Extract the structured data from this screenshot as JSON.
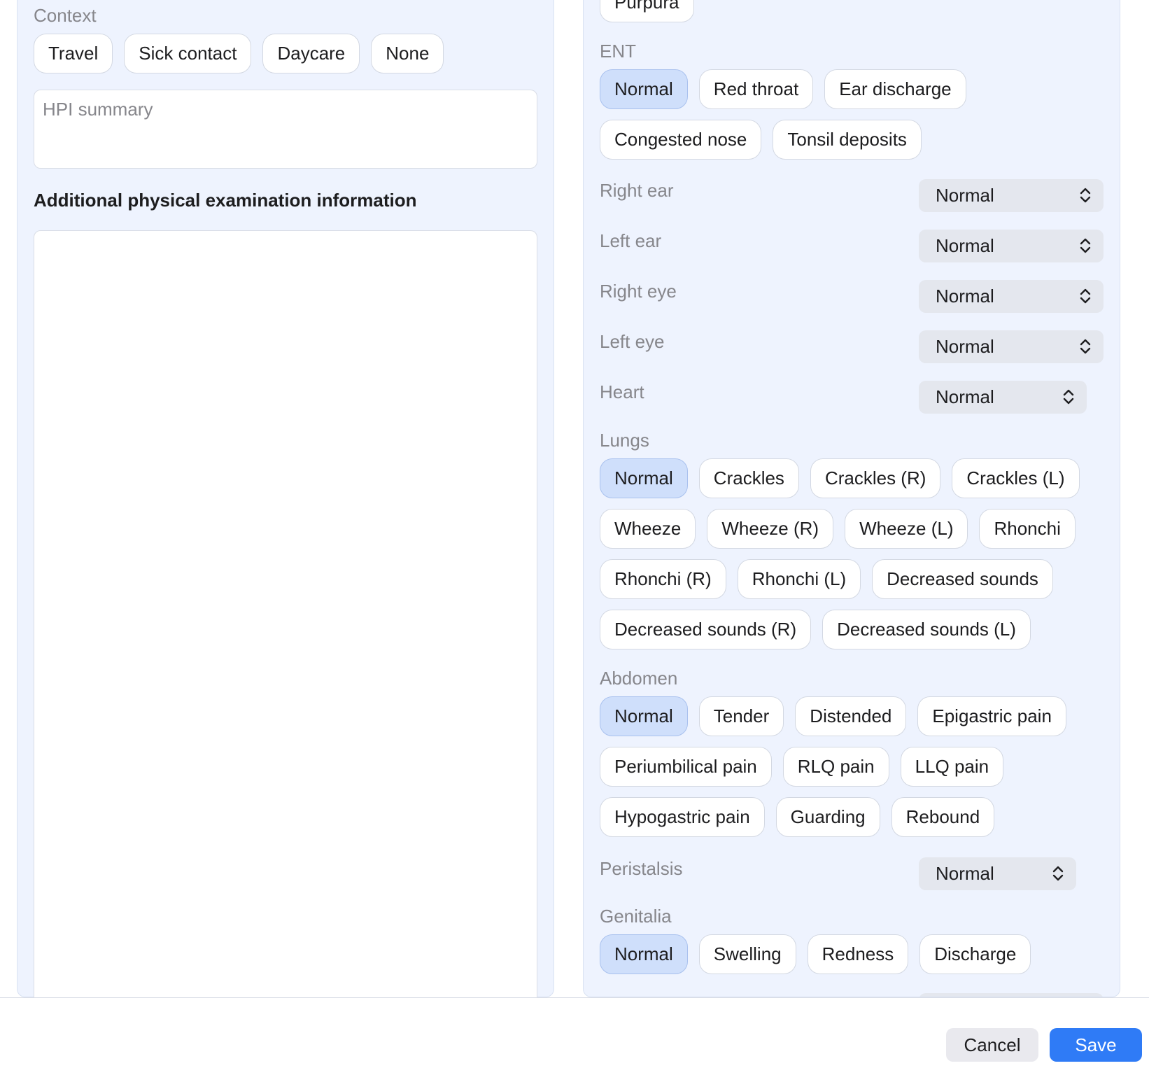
{
  "left": {
    "context_label": "Context",
    "context_chips": [
      "Travel",
      "Sick contact",
      "Daycare",
      "None"
    ],
    "hpi_placeholder": "HPI summary",
    "additional_heading": "Additional physical examination information"
  },
  "right": {
    "top_chip": "Purpura",
    "ent": {
      "label": "ENT",
      "row1": [
        "Normal",
        "Red throat",
        "Ear discharge"
      ],
      "row2": [
        "Congested nose",
        "Tonsil deposits"
      ]
    },
    "selects": [
      {
        "label": "Right ear",
        "value": "Normal"
      },
      {
        "label": "Left ear",
        "value": "Normal"
      },
      {
        "label": "Right eye",
        "value": "Normal"
      },
      {
        "label": "Left eye",
        "value": "Normal"
      },
      {
        "label": "Heart",
        "value": "Normal"
      }
    ],
    "lungs": {
      "label": "Lungs",
      "row1": [
        "Normal",
        "Crackles",
        "Crackles (R)",
        "Crackles (L)"
      ],
      "row2": [
        "Wheeze",
        "Wheeze (R)",
        "Wheeze (L)",
        "Rhonchi"
      ],
      "row3": [
        "Rhonchi (R)",
        "Rhonchi (L)",
        "Decreased sounds"
      ],
      "row4": [
        "Decreased sounds (R)",
        "Decreased sounds (L)"
      ]
    },
    "abdomen": {
      "label": "Abdomen",
      "row1": [
        "Normal",
        "Tender",
        "Distended",
        "Epigastric pain"
      ],
      "row2": [
        "Periumbilical pain",
        "RLQ pain",
        "LLQ pain"
      ],
      "row3": [
        "Hypogastric pain",
        "Guarding",
        "Rebound"
      ]
    },
    "peristalsis": {
      "label": "Peristalsis",
      "value": "Normal"
    },
    "genitalia": {
      "label": "Genitalia",
      "row1": [
        "Normal",
        "Swelling",
        "Redness",
        "Discharge"
      ]
    }
  },
  "footer": {
    "cancel_label": "Cancel",
    "save_label": "Save"
  },
  "colors": {
    "accent": "#2f7bf6",
    "selected_chip": "#cfdffb",
    "panel_bg": "#eef3fe"
  }
}
